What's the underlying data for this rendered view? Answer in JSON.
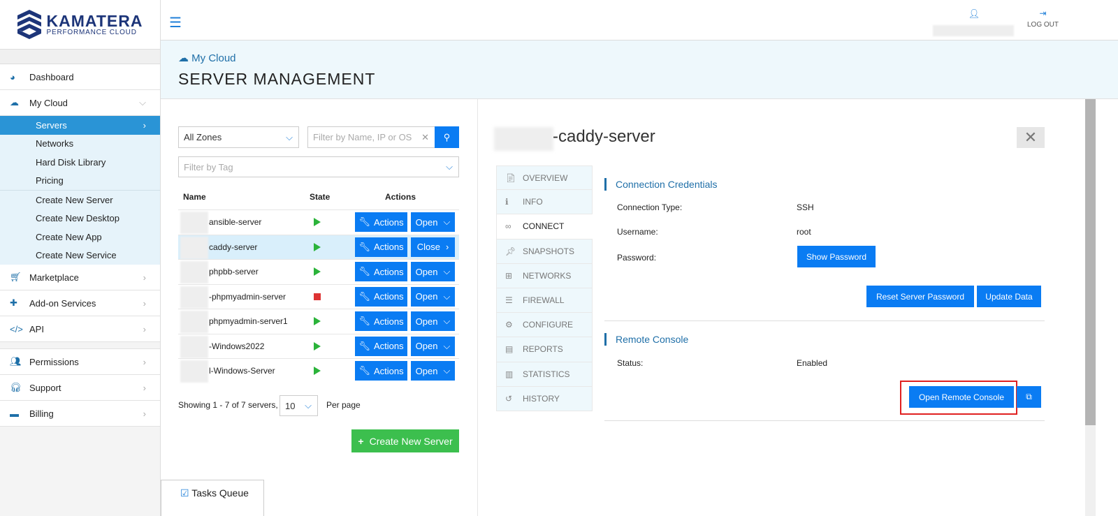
{
  "brand": {
    "name": "KAMATERA",
    "tagline": "PERFORMANCE CLOUD"
  },
  "sidebar": {
    "items": [
      {
        "label": "Dashboard"
      },
      {
        "label": "My Cloud"
      }
    ],
    "sub": [
      {
        "label": "Servers"
      },
      {
        "label": "Networks"
      },
      {
        "label": "Hard Disk Library"
      },
      {
        "label": "Pricing"
      },
      {
        "label": "Create New Server"
      },
      {
        "label": "Create New Desktop"
      },
      {
        "label": "Create New App"
      },
      {
        "label": "Create New Service"
      }
    ],
    "more": [
      {
        "label": "Marketplace"
      },
      {
        "label": "Add-on Services"
      },
      {
        "label": "API"
      }
    ],
    "bottom": [
      {
        "label": "Permissions"
      },
      {
        "label": "Support"
      },
      {
        "label": "Billing"
      }
    ]
  },
  "topbar": {
    "logout": "LOG OUT"
  },
  "header": {
    "breadcrumb": "My Cloud",
    "title": "SERVER MANAGEMENT"
  },
  "filters": {
    "zone": "All Zones",
    "search_placeholder": "Filter by Name, IP or OS",
    "tag_placeholder": "Filter by Tag"
  },
  "table": {
    "headers": [
      "Name",
      "State",
      "Actions"
    ],
    "actions_label": "Actions",
    "rows": [
      {
        "name": "ansible-server",
        "state": "running",
        "toggle": "Open"
      },
      {
        "name": "caddy-server",
        "state": "running",
        "toggle": "Close"
      },
      {
        "name": "phpbb-server",
        "state": "running",
        "toggle": "Open"
      },
      {
        "name": "-phpmyadmin-server",
        "state": "stopped",
        "toggle": "Open"
      },
      {
        "name": "phpmyadmin-server1",
        "state": "running",
        "toggle": "Open"
      },
      {
        "name": "-Windows2022",
        "state": "running",
        "toggle": "Open"
      },
      {
        "name": "l-Windows-Server",
        "state": "running",
        "toggle": "Open"
      }
    ]
  },
  "pagination": {
    "showing": "Showing 1 - 7 of 7 servers,",
    "per_page_value": "10",
    "per_page_label": "Per page"
  },
  "create_button": "Create New Server",
  "tasks": "Tasks Queue",
  "detail": {
    "title": "-caddy-server",
    "tabs": [
      "OVERVIEW",
      "INFO",
      "CONNECT",
      "SNAPSHOTS",
      "NETWORKS",
      "FIREWALL",
      "CONFIGURE",
      "REPORTS",
      "STATISTICS",
      "HISTORY"
    ],
    "credentials": {
      "title": "Connection Credentials",
      "type_label": "Connection Type:",
      "type_value": "SSH",
      "user_label": "Username:",
      "user_value": "root",
      "pass_label": "Password:",
      "show_password": "Show Password",
      "reset": "Reset Server Password",
      "update": "Update Data"
    },
    "console": {
      "title": "Remote Console",
      "status_label": "Status:",
      "status_value": "Enabled",
      "open": "Open Remote Console"
    }
  }
}
